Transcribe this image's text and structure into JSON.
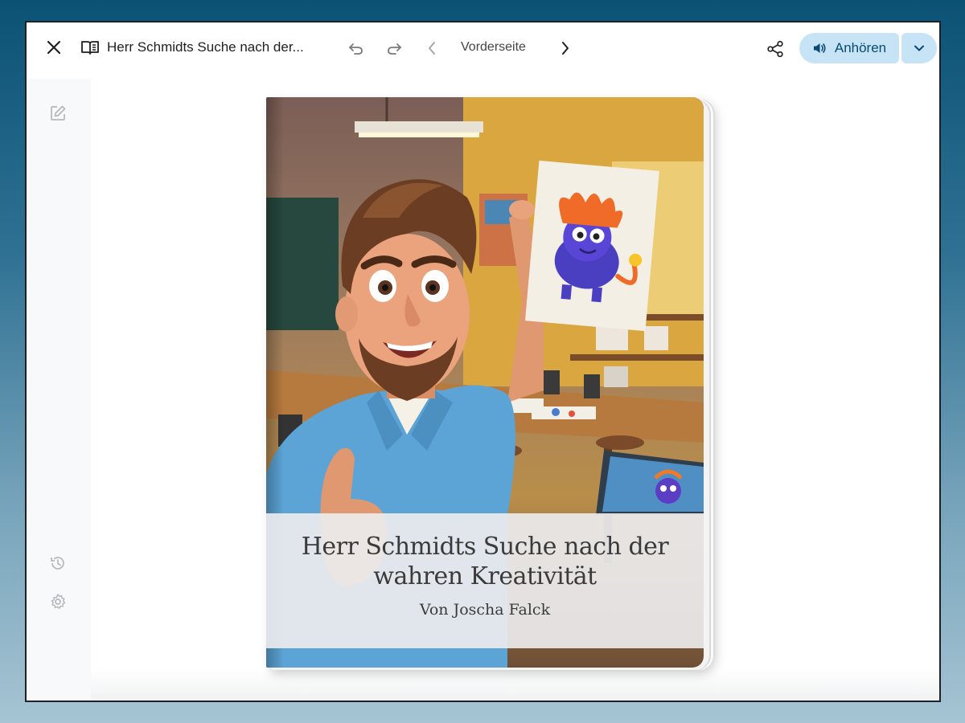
{
  "toolbar": {
    "close_icon": "close-icon",
    "book_icon": "book-icon",
    "title": "Herr Schmidts Suche nach der...",
    "undo_icon": "undo-icon",
    "redo_icon": "redo-icon",
    "prev_icon": "chevron-left-icon",
    "page_label": "Vorderseite",
    "next_icon": "chevron-right-icon",
    "share_icon": "share-icon",
    "listen_label": "Anhören",
    "listen_icon": "speaker-icon",
    "listen_menu_icon": "chevron-down-icon",
    "accent_color": "#c6e4f6"
  },
  "sidebar": {
    "items": [
      {
        "icon": "edit-icon"
      },
      {
        "icon": "history-icon"
      },
      {
        "icon": "settings-icon"
      }
    ]
  },
  "book": {
    "title": "Herr Schmidts Suche nach der wahren Kreativität",
    "title_line1": "Herr Schmidts Suche nach der",
    "title_line2": "wahren Kreativität",
    "author": "Von Joscha Falck"
  }
}
